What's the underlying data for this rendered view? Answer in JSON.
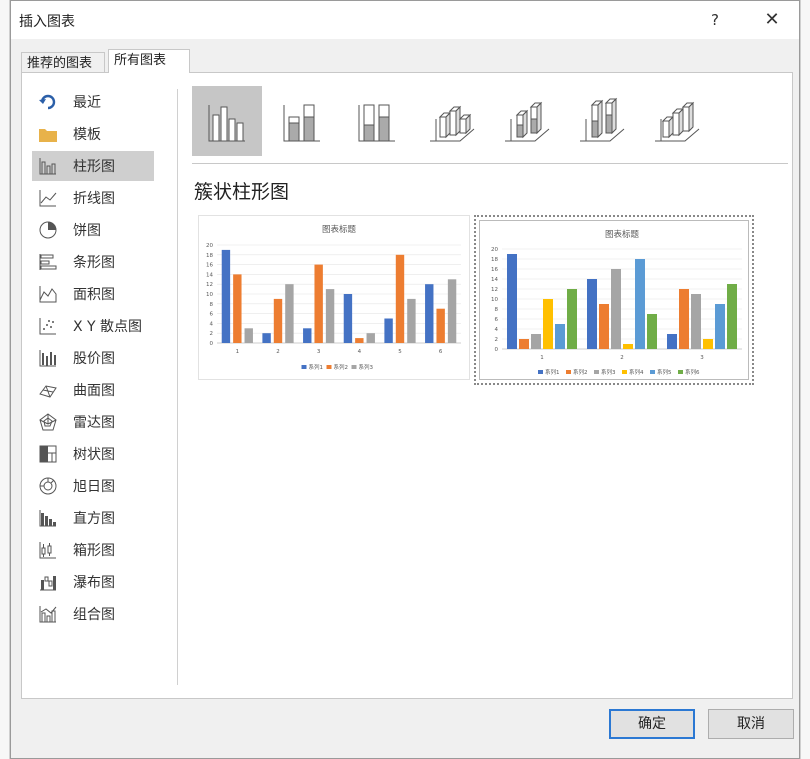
{
  "dialog": {
    "title": "插入图表",
    "help_label": "?",
    "close_label": "✕"
  },
  "tabs": [
    {
      "label": "推荐的图表",
      "active": false
    },
    {
      "label": "所有图表",
      "active": true
    }
  ],
  "sidebar": {
    "items": [
      {
        "label": "最近",
        "icon": "recent-icon"
      },
      {
        "label": "模板",
        "icon": "folder-icon"
      },
      {
        "label": "柱形图",
        "icon": "column-chart-icon",
        "selected": true
      },
      {
        "label": "折线图",
        "icon": "line-chart-icon"
      },
      {
        "label": "饼图",
        "icon": "pie-chart-icon"
      },
      {
        "label": "条形图",
        "icon": "bar-chart-icon"
      },
      {
        "label": "面积图",
        "icon": "area-chart-icon"
      },
      {
        "label": "X Y 散点图",
        "icon": "scatter-chart-icon"
      },
      {
        "label": "股价图",
        "icon": "stock-chart-icon"
      },
      {
        "label": "曲面图",
        "icon": "surface-chart-icon"
      },
      {
        "label": "雷达图",
        "icon": "radar-chart-icon"
      },
      {
        "label": "树状图",
        "icon": "treemap-chart-icon"
      },
      {
        "label": "旭日图",
        "icon": "sunburst-chart-icon"
      },
      {
        "label": "直方图",
        "icon": "histogram-chart-icon"
      },
      {
        "label": "箱形图",
        "icon": "box-whisker-chart-icon"
      },
      {
        "label": "瀑布图",
        "icon": "waterfall-chart-icon"
      },
      {
        "label": "组合图",
        "icon": "combo-chart-icon"
      }
    ]
  },
  "subtypes": [
    {
      "icon": "clustered-column-icon",
      "selected": true
    },
    {
      "icon": "stacked-column-icon"
    },
    {
      "icon": "100-stacked-column-icon"
    },
    {
      "icon": "3d-clustered-column-icon"
    },
    {
      "icon": "3d-stacked-column-icon"
    },
    {
      "icon": "3d-100-stacked-column-icon"
    },
    {
      "icon": "3d-column-icon"
    }
  ],
  "chart_type_title": "簇状柱形图",
  "colors": {
    "series": [
      "#4472c4",
      "#ed7d31",
      "#a5a5a5",
      "#ffc000",
      "#5b9bd5",
      "#70ad47"
    ],
    "selected_bg": "#cfcfcf",
    "ok_border": "#2b78d3"
  },
  "chart_data": [
    {
      "type": "bar",
      "title": "图表标题",
      "categories": [
        "1",
        "2",
        "3",
        "4",
        "5",
        "6"
      ],
      "series": [
        {
          "name": "系列1",
          "values": [
            19,
            2,
            3,
            10,
            5,
            12
          ]
        },
        {
          "name": "系列2",
          "values": [
            14,
            9,
            16,
            1,
            18,
            7
          ]
        },
        {
          "name": "系列3",
          "values": [
            3,
            12,
            11,
            2,
            9,
            13
          ]
        }
      ],
      "ylim": [
        0,
        20
      ],
      "yticks": [
        0,
        2,
        4,
        6,
        8,
        10,
        12,
        14,
        16,
        18,
        20
      ],
      "legend": "bottom",
      "grid": true
    },
    {
      "type": "bar",
      "title": "图表标题",
      "categories": [
        "1",
        "2",
        "3"
      ],
      "series": [
        {
          "name": "系列1",
          "values": [
            19,
            14,
            3
          ]
        },
        {
          "name": "系列2",
          "values": [
            2,
            9,
            12
          ]
        },
        {
          "name": "系列3",
          "values": [
            3,
            16,
            11
          ]
        },
        {
          "name": "系列4",
          "values": [
            10,
            1,
            2
          ]
        },
        {
          "name": "系列5",
          "values": [
            5,
            18,
            9
          ]
        },
        {
          "name": "系列6",
          "values": [
            12,
            7,
            13
          ]
        }
      ],
      "ylim": [
        0,
        20
      ],
      "yticks": [
        0,
        2,
        4,
        6,
        8,
        10,
        12,
        14,
        16,
        18,
        20
      ],
      "legend": "bottom",
      "grid": true
    }
  ],
  "buttons": {
    "ok": "确定",
    "cancel": "取消"
  }
}
